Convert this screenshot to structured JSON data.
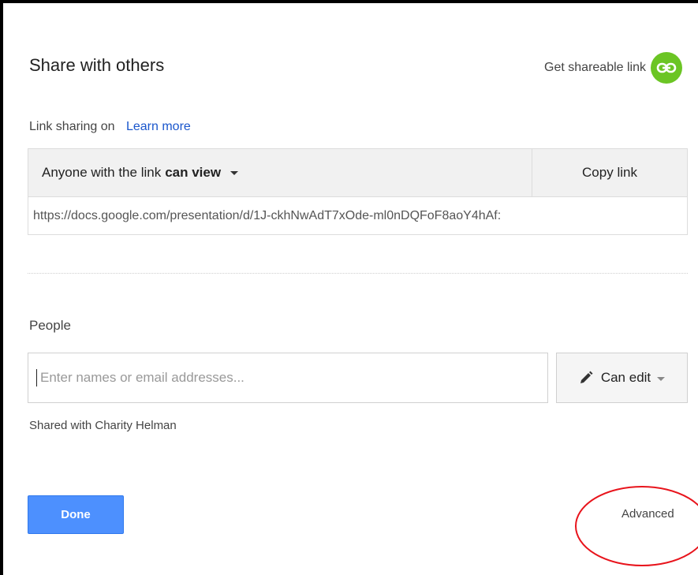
{
  "dialog": {
    "title": "Share with others",
    "get_shareable_link": "Get shareable link"
  },
  "link_sharing": {
    "status": "Link sharing on",
    "learn_more": "Learn more",
    "access_prefix": "Anyone with the link",
    "access_level": "can view",
    "copy_link": "Copy link",
    "url": "https://docs.google.com/presentation/d/1J-ckhNwAdT7xOde-ml0nDQFoF8aoY4hAf:"
  },
  "people": {
    "label": "People",
    "input_placeholder": "Enter names or email addresses...",
    "input_value": "",
    "permission": "Can edit",
    "shared_with": "Shared with Charity Helman"
  },
  "footer": {
    "done": "Done",
    "advanced": "Advanced"
  },
  "icons": {
    "link": "link-icon",
    "pencil": "pencil-icon",
    "dropdown": "caret-down-icon"
  },
  "colors": {
    "link_icon_bg": "#6bc524",
    "learn_more": "#1a56cc",
    "done_button": "#4d90fe",
    "annotation_ellipse": "#e8141c"
  }
}
